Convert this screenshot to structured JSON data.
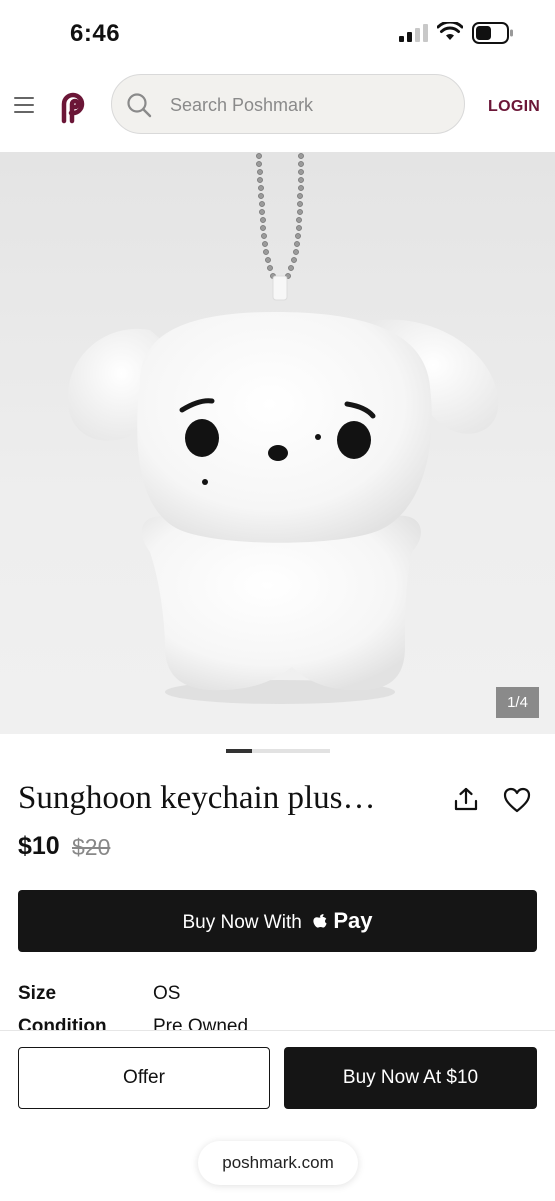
{
  "status_bar": {
    "time": "6:46"
  },
  "header": {
    "search_placeholder": "Search Poshmark",
    "login_label": "LOGIN"
  },
  "gallery": {
    "counter": "1/4",
    "current": 1,
    "total": 4
  },
  "product": {
    "title": "Sunghoon keychain plus…",
    "price": "$10",
    "original_price": "$20"
  },
  "buttons": {
    "apple_pay_prefix": "Buy Now With",
    "apple_pay_brand": "Pay",
    "offer": "Offer",
    "buy_now": "Buy Now At $10"
  },
  "details": [
    {
      "label": "Size",
      "value": "OS"
    },
    {
      "label": "Condition",
      "value": "Pre Owned"
    }
  ],
  "browser": {
    "url": "poshmark.com"
  },
  "colors": {
    "brand": "#6b1637",
    "button_dark": "#151515"
  }
}
